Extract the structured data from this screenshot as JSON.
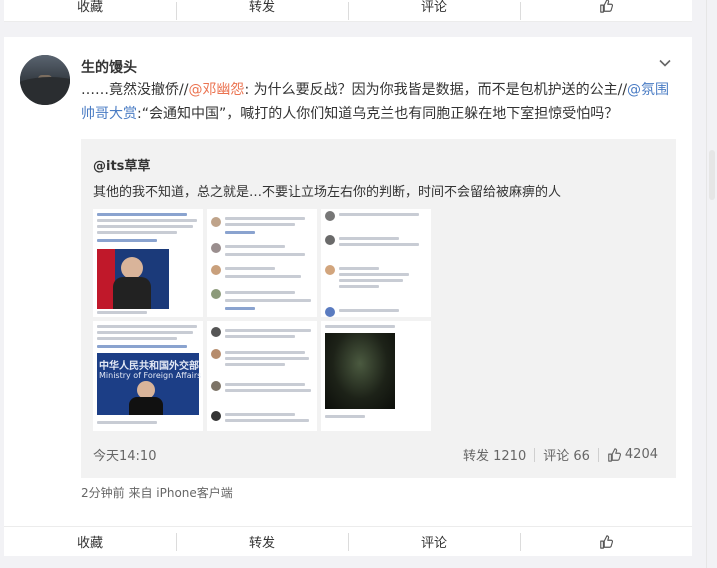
{
  "top_bar": {
    "favorite": "收藏",
    "repost": "转发",
    "comment": "评论"
  },
  "post": {
    "username": "生的馒头",
    "text": {
      "prefix": "……竟然没撤侨//",
      "mention1": "@邓幽怨",
      "part1": ": 为什么要反战？因为你我皆是数据，而不是包机护送的公主//",
      "mention2": "@氛围帅哥大赏",
      "part2": ":“会通知中国”，喊打的人你们知道乌克兰也有同胞正躲在地下室担惊受怕吗？"
    },
    "meta_text": "2分钟前  来自 iPhone客户端"
  },
  "repost": {
    "author": "@its草草",
    "text": "其他的我不知道，总之就是…不要让立场左右你的判断，时间不会留给被麻痹的人",
    "images": {
      "ministry_name": "中华人民共和国外交部",
      "ministry_en": "Ministry of Foreign Affairs"
    },
    "time": "今天14:10",
    "reposts": "转发 1210",
    "comments": "评论 66",
    "likes": "4204"
  },
  "bottom_bar": {
    "favorite": "收藏",
    "repost": "转发",
    "comment": "评论"
  },
  "colors": {
    "mention": "#eb7350",
    "link": "#4a7cc4",
    "repost_bg": "#f2f2f2",
    "page_bg": "#f2f2f5"
  },
  "icons": {
    "like": "thumbs-up-icon",
    "more": "chevron-down-icon"
  }
}
